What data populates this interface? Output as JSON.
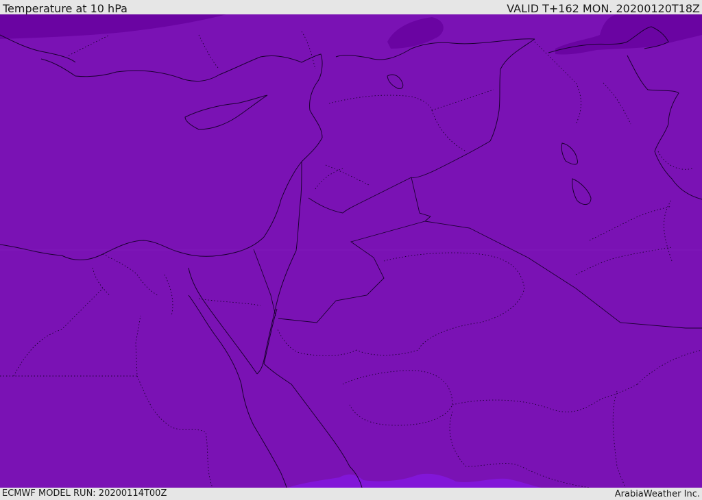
{
  "header": {
    "title": "Temperature at 10 hPa",
    "valid": "VALID T+162 MON. 20200120T18Z"
  },
  "footer": {
    "model_run": "ECMWF MODEL RUN: 20200114T00Z",
    "credit": "ArabiaWeather Inc."
  },
  "map": {
    "colors": {
      "fill_main": "#7a12b4",
      "fill_dark": "#6a04a2",
      "fill_light": "#8216d8",
      "line": "#1a0030"
    }
  }
}
